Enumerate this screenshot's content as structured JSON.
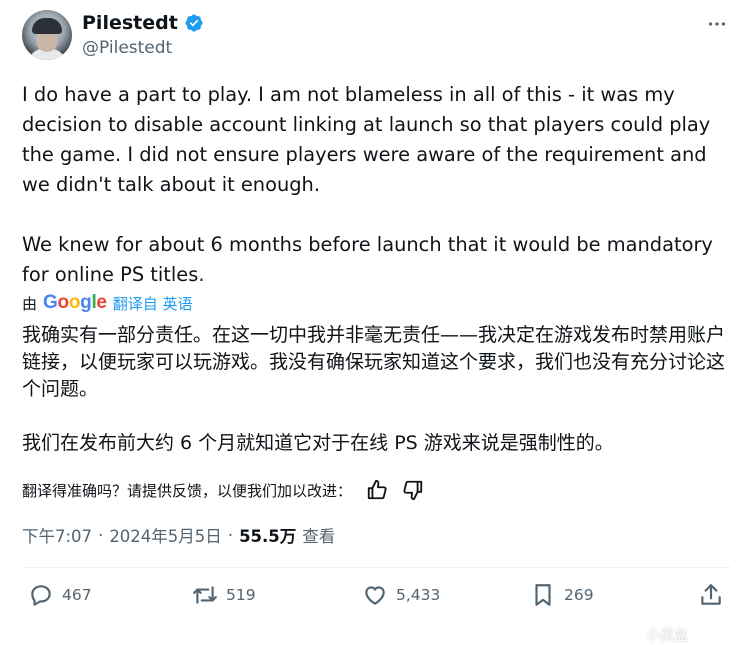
{
  "author": {
    "display_name": "Pilestedt",
    "handle": "@Pilestedt"
  },
  "tweet": {
    "text_en": "I do have a part to play. I am not blameless in all of this - it was my decision to disable account linking at launch so that players could play the game. I did not ensure players were aware of the requirement and we didn't talk about it enough.\n\nWe knew for about 6 months before launch that it would be mandatory for online PS titles.",
    "translation": {
      "by_label": "由",
      "provider": "Google",
      "link_label": "翻译自 英语"
    },
    "text_zh": "我确实有一部分责任。在这一切中我并非毫无责任——我决定在游戏发布时禁用账户链接，以便玩家可以玩游戏。我没有确保玩家知道这个要求，我们也没有充分讨论这个问题。\n\n我们在发布前大约 6 个月就知道它对于在线 PS 游戏来说是强制性的。",
    "feedback_prompt": "翻译得准确吗？请提供反馈，以便我们加以改进："
  },
  "meta": {
    "time": "下午7:07",
    "date": "2024年5月5日",
    "separator": "·",
    "views_count": "55.5万",
    "views_label": "查看"
  },
  "actions": {
    "replies": "467",
    "retweets": "519",
    "likes": "5,433",
    "bookmarks": "269"
  },
  "icons": [
    "verified-badge-icon",
    "more-icon",
    "thumbs-up-icon",
    "thumbs-down-icon",
    "reply-icon",
    "retweet-icon",
    "like-icon",
    "bookmark-icon",
    "share-icon"
  ],
  "colors": {
    "text": "#0f1419",
    "secondary": "#536471",
    "accent": "#1d9bf0"
  },
  "watermark": "小黑盒"
}
